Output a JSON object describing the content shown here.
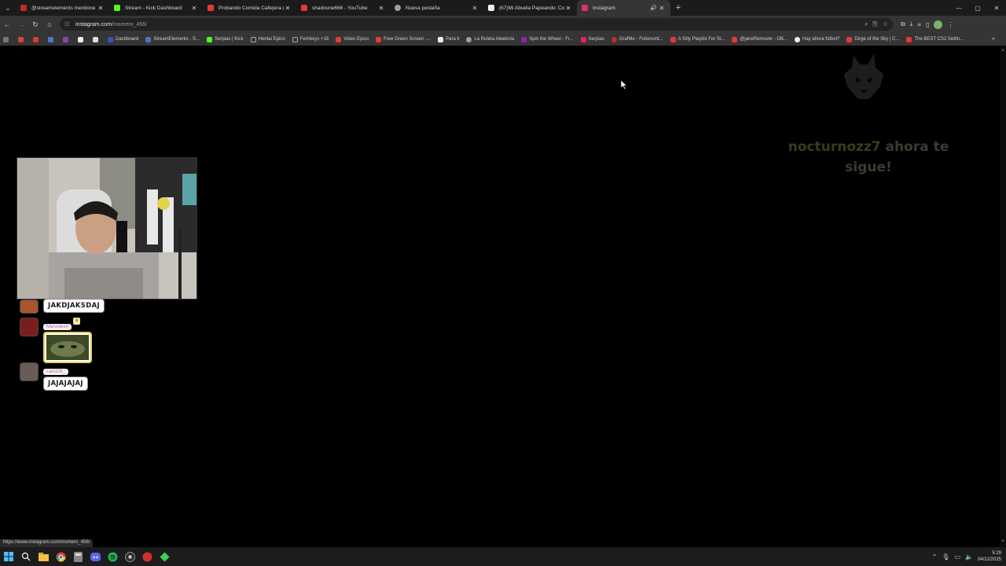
{
  "tabs": [
    {
      "title": "@streamelements mentione",
      "color": "#c62828"
    },
    {
      "title": "Stream - Kick Dashboard",
      "color": "#53fc18"
    },
    {
      "title": "Probando Comida Callejera de",
      "color": "#e53935"
    },
    {
      "title": "shadoune666 - YouTube",
      "color": "#e53935"
    },
    {
      "title": "Nueva pestaña",
      "color": "#9e9e9e"
    },
    {
      "title": "(67)Mi Abuela Papeando: Com",
      "color": "#eeeeee"
    },
    {
      "title": "Instagram",
      "color": "#e1306c"
    }
  ],
  "address": {
    "host": "instagram.com",
    "path": "/momero_456/"
  },
  "bookmarks": [
    {
      "label": "Dashboard",
      "color": "#3f51b5"
    },
    {
      "label": "StreamElements - S...",
      "color": "#5c6bc0"
    },
    {
      "label": "Serpias | Kick",
      "color": "#53fc18"
    },
    {
      "label": "Hentai Epico",
      "color": "#9e9e9e"
    },
    {
      "label": "Femboys +18",
      "color": "#9e9e9e"
    },
    {
      "label": "Video Epico",
      "color": "#e53935"
    },
    {
      "label": "Free Green Screen -...",
      "color": "#e53935"
    },
    {
      "label": "Para ti",
      "color": "#eeeeee"
    },
    {
      "label": "La Ruleta Aleatoria",
      "color": "#9e9e9e"
    },
    {
      "label": "Spin the Wheel - Fr...",
      "color": "#8e24aa"
    },
    {
      "label": "Serpias",
      "color": "#e91e63"
    },
    {
      "label": "GrafMe - Fotomont...",
      "color": "#c62828"
    },
    {
      "label": "A Silly Playlist For Si...",
      "color": "#e53935"
    },
    {
      "label": "@janeRemover - OB...",
      "color": "#e53935"
    },
    {
      "label": "Hay ahora fútbol?",
      "color": "#eeeeee"
    },
    {
      "label": "Dirge of the Sky | C...",
      "color": "#e53935"
    },
    {
      "label": "The BEST CS2 Settin...",
      "color": "#e53935"
    }
  ],
  "alert": {
    "username": "nocturnozz7",
    "message": " ahora te sigue!"
  },
  "chat": [
    {
      "text": "JAKDJAKSDAJ"
    },
    {
      "username": "MarvelexX"
    },
    {
      "username": "Larzzzk_",
      "text": "JAJAJAJAJ"
    }
  ],
  "status_url": "https://www.instagram.com/momero_456/",
  "clock": {
    "time": "5:29",
    "date": "04/12/2025"
  },
  "colors": {
    "accent": "#e1306c",
    "kick": "#53fc18"
  }
}
